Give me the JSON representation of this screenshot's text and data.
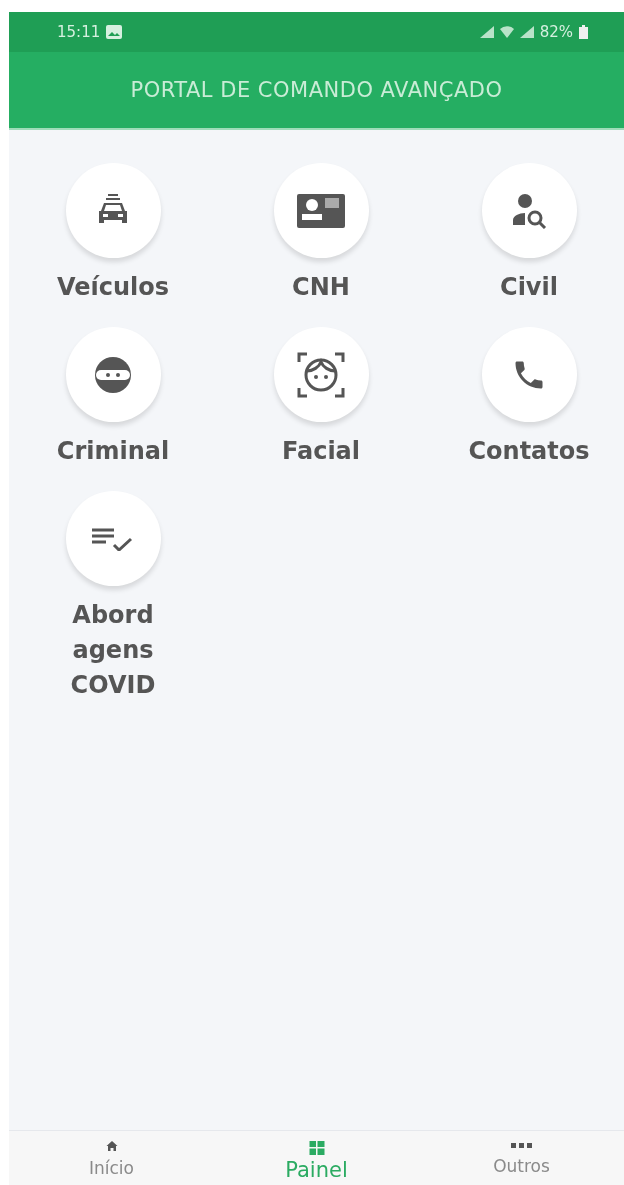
{
  "status_bar": {
    "time": "15:11",
    "battery": "82%"
  },
  "header": {
    "title": "PORTAL DE COMANDO AVANÇADO"
  },
  "tiles": [
    {
      "kind": "car",
      "label": "Veículos"
    },
    {
      "kind": "card",
      "label": "CNH"
    },
    {
      "kind": "person-search",
      "label": "Civil"
    },
    {
      "kind": "mask",
      "label": "Criminal"
    },
    {
      "kind": "face",
      "label": "Facial"
    },
    {
      "kind": "phone",
      "label": "Contatos"
    },
    {
      "kind": "checklist",
      "label": "Abordagens COVID"
    }
  ],
  "bottom_nav": [
    {
      "kind": "home",
      "label": "Início",
      "selected": false
    },
    {
      "kind": "grid",
      "label": "Painel",
      "selected": true
    },
    {
      "kind": "more",
      "label": "Outros",
      "selected": false
    }
  ]
}
